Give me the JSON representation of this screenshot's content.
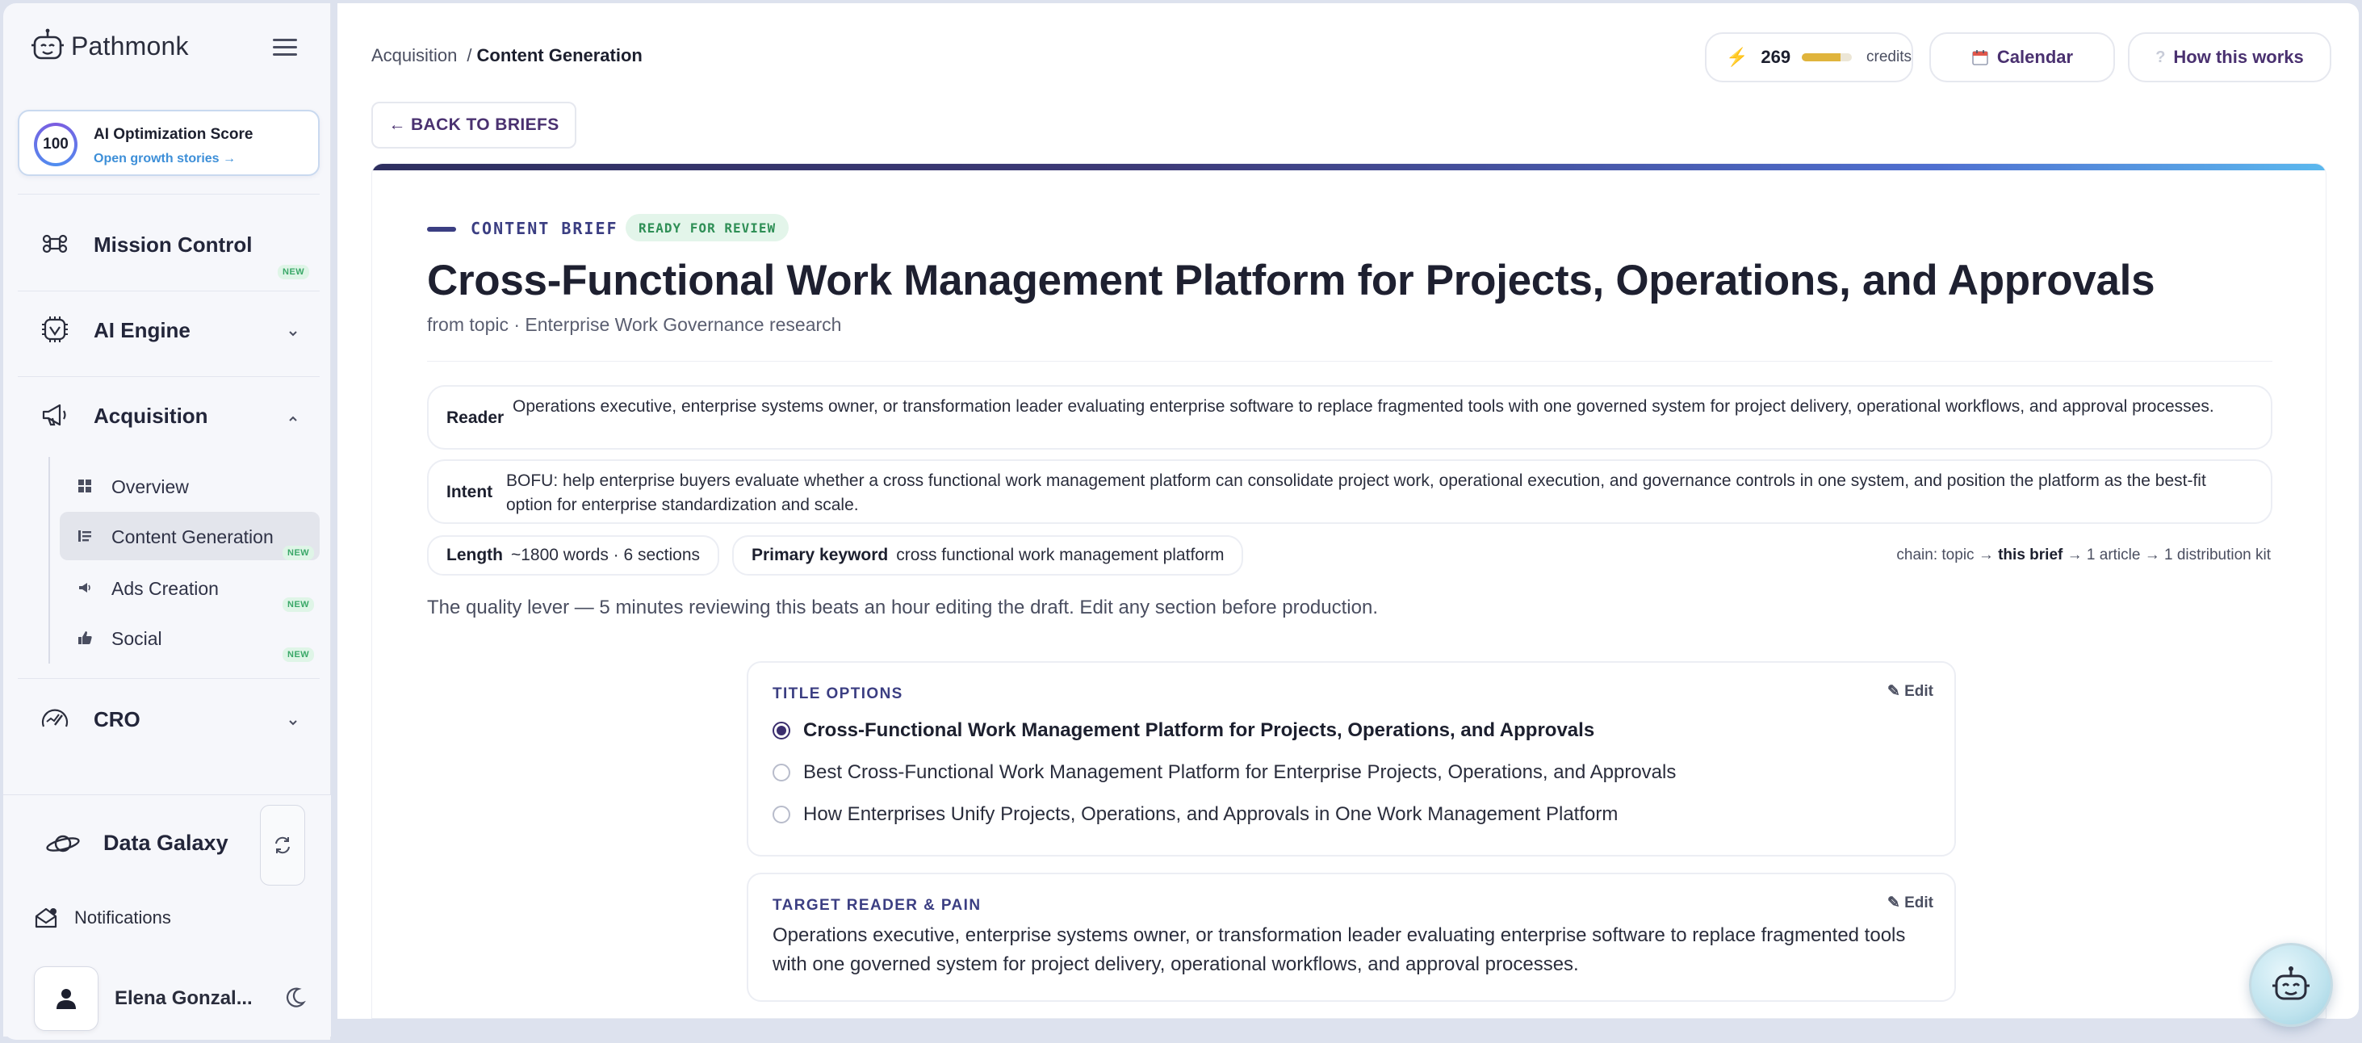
{
  "brand": {
    "name": "Pathmonk"
  },
  "score": {
    "value": "100",
    "title": "AI Optimization Score",
    "link": "Open growth stories →"
  },
  "nav": {
    "mission_control": {
      "label": "Mission Control",
      "badge": "NEW"
    },
    "ai_engine": {
      "label": "AI Engine"
    },
    "acquisition": {
      "label": "Acquisition"
    },
    "cro": {
      "label": "CRO"
    },
    "sub_items": [
      {
        "label": "Overview",
        "badge": ""
      },
      {
        "label": "Content Generation",
        "badge": "NEW"
      },
      {
        "label": "Ads Creation",
        "badge": "NEW"
      },
      {
        "label": "Social",
        "badge": "NEW"
      }
    ]
  },
  "galaxy": {
    "label": "Data Galaxy"
  },
  "notifications": {
    "label": "Notifications"
  },
  "user": {
    "name": "Elena Gonzal..."
  },
  "breadcrumb": {
    "parent": "Acquisition",
    "separator": "/",
    "current": "Content Generation"
  },
  "credits": {
    "value": "269",
    "word": "credits",
    "fill_fraction": 0.78
  },
  "toolbar": {
    "calendar_label": "Calendar",
    "how_label": "How this works",
    "back_label": "← BACK TO BRIEFS"
  },
  "brief": {
    "kicker": "CONTENT BRIEF",
    "status": "READY FOR REVIEW",
    "title": "Cross-Functional Work Management Platform for Projects, Operations, and Approvals",
    "subtitle": "from topic · Enterprise Work Governance research",
    "reader_label": "Reader",
    "reader_text": "Operations executive, enterprise systems owner, or transformation leader evaluating enterprise software to replace fragmented tools with one governed system for project delivery, operational workflows, and approval processes.",
    "intent_label": "Intent",
    "intent_text": "BOFU: help enterprise buyers evaluate whether a cross functional work management platform can consolidate project work, operational execution, and governance controls in one system, and position the platform as the best-fit option for enterprise standardization and scale.",
    "length_label": "Length",
    "length_value": "~1800 words · 6 sections",
    "keyword_label": "Primary keyword",
    "keyword_value": "cross functional work management platform",
    "chain_prefix": "chain: topic →",
    "chain_current": "this brief",
    "chain_suffix": "→ 1 article → 1 distribution kit",
    "quality_note": "The quality lever — 5 minutes reviewing this beats an hour editing the draft. Edit any section before production."
  },
  "title_options": {
    "heading": "TITLE OPTIONS",
    "edit_label": "✎ Edit",
    "options": [
      "Cross-Functional Work Management Platform for Projects, Operations, and Approvals",
      "Best Cross-Functional Work Management Platform for Enterprise Projects, Operations, and Approvals",
      "How Enterprises Unify Projects, Operations, and Approvals in One Work Management Platform"
    ],
    "selected_index": 0
  },
  "reader_pain": {
    "heading": "TARGET READER & PAIN",
    "edit_label": "✎ Edit",
    "text": "Operations executive, enterprise systems owner, or transformation leader evaluating enterprise software to replace fragmented tools with one governed system for project delivery, operational workflows, and approval processes."
  },
  "colors": {
    "accent": "#3b3e82",
    "brand_purple": "#4a3170",
    "status_green": "#2f8f56",
    "credit_gold": "#e0b43c"
  }
}
